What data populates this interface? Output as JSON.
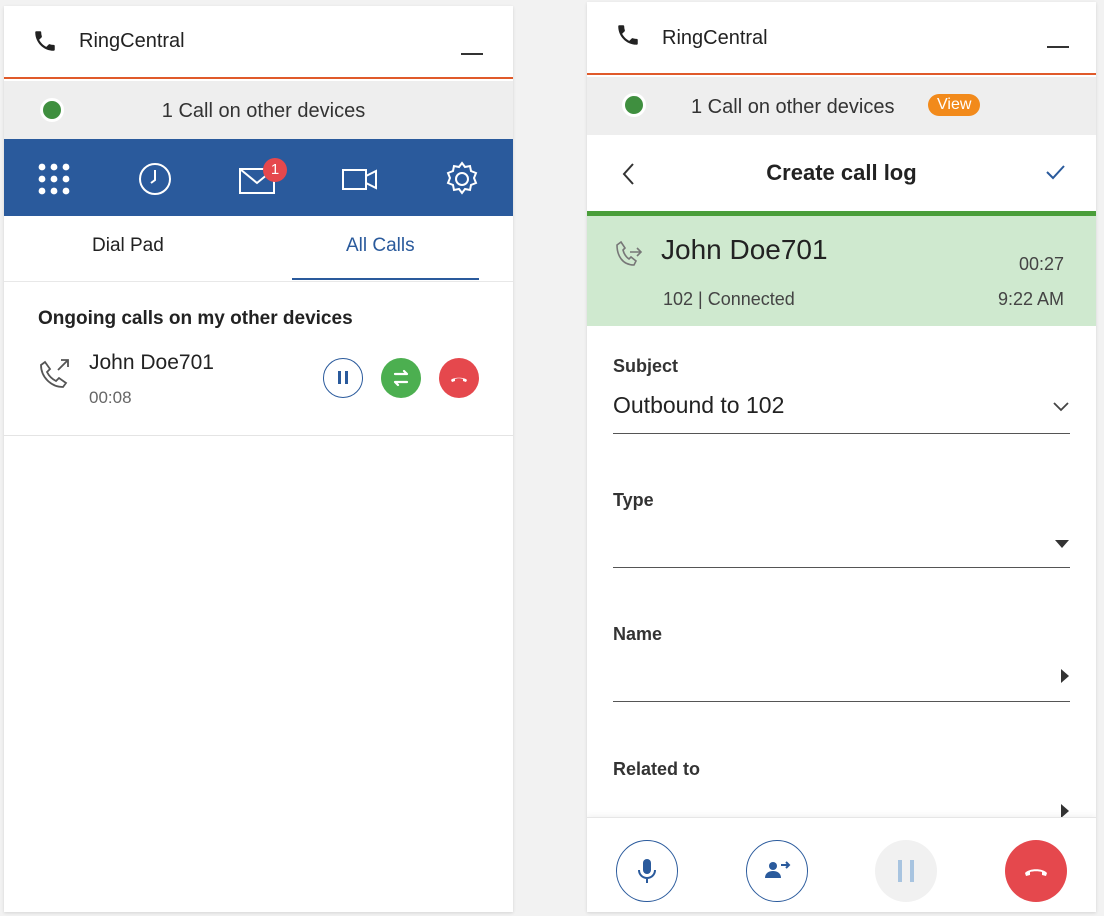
{
  "left": {
    "app_title": "RingCentral",
    "status_text": "1 Call on other devices",
    "nav": {
      "items": [
        "dialpad-icon",
        "history-icon",
        "messages-icon",
        "video-icon",
        "settings-icon"
      ],
      "messages_badge": "1"
    },
    "tabs": [
      {
        "label": "Dial Pad",
        "active": false
      },
      {
        "label": "All Calls",
        "active": true
      }
    ],
    "section_title": "Ongoing calls on my other devices",
    "call": {
      "name": "John Doe701",
      "duration": "00:08"
    }
  },
  "right": {
    "app_title": "RingCentral",
    "status_text": "1 Call on other devices",
    "view_label": "View",
    "header_title": "Create call log",
    "call": {
      "name": "John Doe701",
      "status": "102 | Connected",
      "duration": "00:27",
      "time": "9:22 AM"
    },
    "form": {
      "subject_label": "Subject",
      "subject_value": "Outbound to 102",
      "type_label": "Type",
      "type_value": "",
      "name_label": "Name",
      "name_value": "",
      "related_label": "Related to",
      "related_value": ""
    },
    "footer_buttons": [
      "mute-icon",
      "transfer-icon",
      "hold-icon",
      "hangup-icon"
    ]
  },
  "colors": {
    "accent_line": "#e05a2a",
    "nav_blue": "#2a5a9c",
    "online_green": "#3f8f3f",
    "badge_orange": "#f28a1b",
    "hangup_red": "#e5484d",
    "flip_green": "#4caf50",
    "call_card": "#cfe9cf"
  }
}
